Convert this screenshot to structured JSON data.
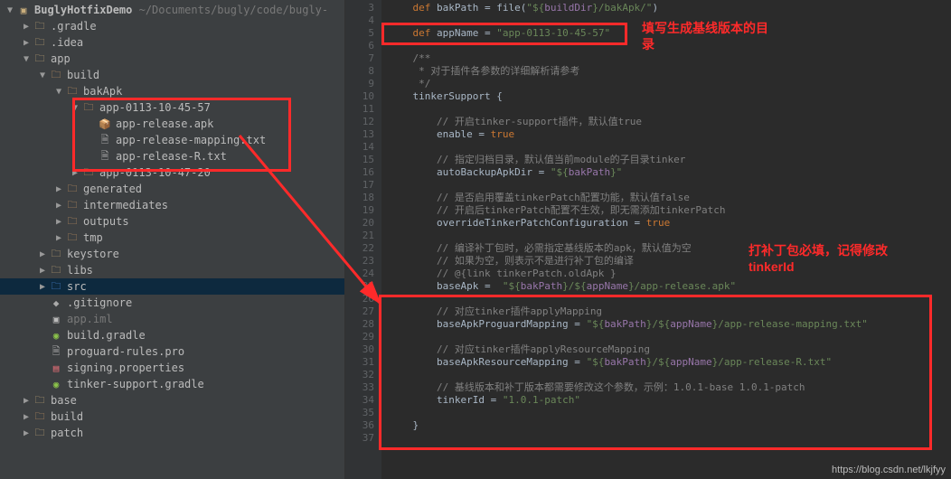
{
  "project": {
    "root_name": "BuglyHotfixDemo",
    "root_path": "~/Documents/bugly/code/bugly-",
    "tree": {
      "gradle": ".gradle",
      "idea": ".idea",
      "app": {
        "label": "app",
        "build": {
          "label": "build",
          "bakApk": {
            "label": "bakApk",
            "dir1": {
              "label": "app-0113-10-45-57",
              "f1": "app-release.apk",
              "f2": "app-release-mapping.txt",
              "f3": "app-release-R.txt"
            },
            "dir2": "app-0113-10-47-20"
          },
          "generated": "generated",
          "intermediates": "intermediates",
          "outputs": "outputs",
          "tmp": "tmp"
        },
        "keystore": "keystore",
        "libs": "libs",
        "src": "src",
        "gitignore": ".gitignore",
        "appiml": "app.iml",
        "buildgradle": "build.gradle",
        "proguard": "proguard-rules.pro",
        "signing": "signing.properties",
        "tinker": "tinker-support.gradle"
      },
      "base": "base",
      "build": "build",
      "patch": "patch"
    }
  },
  "annotations": {
    "top": "填写生成基线版本的目录",
    "bottom": "打补丁包必填，记得修改tinkerId"
  },
  "watermark": "https://blog.csdn.net/lkjfyy",
  "code": {
    "lines": [
      {
        "n": 3,
        "indent": 1,
        "segs": [
          {
            "t": "def ",
            "c": "kw"
          },
          {
            "t": "bakPath = file(",
            "c": ""
          },
          {
            "t": "\"${",
            "c": "str"
          },
          {
            "t": "buildDir",
            "c": "prop"
          },
          {
            "t": "}/bakApk/\"",
            "c": "str"
          },
          {
            "t": ")",
            "c": ""
          }
        ]
      },
      {
        "n": 4,
        "indent": 0,
        "segs": []
      },
      {
        "n": 5,
        "indent": 1,
        "segs": [
          {
            "t": "def ",
            "c": "kw"
          },
          {
            "t": "appName = ",
            "c": ""
          },
          {
            "t": "\"app-0113-10-45-57\"",
            "c": "str"
          }
        ]
      },
      {
        "n": 6,
        "indent": 0,
        "segs": []
      },
      {
        "n": 7,
        "indent": 1,
        "segs": [
          {
            "t": "/**",
            "c": "cmt"
          }
        ]
      },
      {
        "n": 8,
        "indent": 1,
        "segs": [
          {
            "t": " * 对于插件各参数的详细解析请参考",
            "c": "cmt"
          }
        ]
      },
      {
        "n": 9,
        "indent": 1,
        "segs": [
          {
            "t": " */",
            "c": "cmt"
          }
        ]
      },
      {
        "n": 10,
        "indent": 1,
        "segs": [
          {
            "t": "tinkerSupport {",
            "c": ""
          }
        ]
      },
      {
        "n": 11,
        "indent": 0,
        "segs": []
      },
      {
        "n": 12,
        "indent": 2,
        "segs": [
          {
            "t": "// 开启tinker-support插件，默认值true",
            "c": "cmt"
          }
        ]
      },
      {
        "n": 13,
        "indent": 2,
        "segs": [
          {
            "t": "enable = ",
            "c": ""
          },
          {
            "t": "true",
            "c": "lit"
          }
        ]
      },
      {
        "n": 14,
        "indent": 0,
        "segs": []
      },
      {
        "n": 15,
        "indent": 2,
        "segs": [
          {
            "t": "// 指定归档目录，默认值当前module的子目录tinker",
            "c": "cmt"
          }
        ]
      },
      {
        "n": 16,
        "indent": 2,
        "segs": [
          {
            "t": "autoBackupApkDir = ",
            "c": ""
          },
          {
            "t": "\"${",
            "c": "str"
          },
          {
            "t": "bakPath",
            "c": "prop"
          },
          {
            "t": "}\"",
            "c": "str"
          }
        ]
      },
      {
        "n": 17,
        "indent": 0,
        "segs": []
      },
      {
        "n": 18,
        "indent": 2,
        "segs": [
          {
            "t": "// 是否启用覆盖tinkerPatch配置功能，默认值false",
            "c": "cmt"
          }
        ]
      },
      {
        "n": 19,
        "indent": 2,
        "segs": [
          {
            "t": "// 开启后tinkerPatch配置不生效，即无需添加tinkerPatch",
            "c": "cmt"
          }
        ]
      },
      {
        "n": 20,
        "indent": 2,
        "segs": [
          {
            "t": "overrideTinkerPatchConfiguration = ",
            "c": ""
          },
          {
            "t": "true",
            "c": "lit"
          }
        ]
      },
      {
        "n": 21,
        "indent": 0,
        "segs": []
      },
      {
        "n": 22,
        "indent": 2,
        "segs": [
          {
            "t": "// 编译补丁包时，必需指定基线版本的apk，默认值为空",
            "c": "cmt"
          }
        ]
      },
      {
        "n": 23,
        "indent": 2,
        "segs": [
          {
            "t": "// 如果为空，则表示不是进行补丁包的编译",
            "c": "cmt"
          }
        ]
      },
      {
        "n": 24,
        "indent": 2,
        "segs": [
          {
            "t": "// @{link tinkerPatch.oldApk }",
            "c": "cmt"
          }
        ]
      },
      {
        "n": 25,
        "indent": 2,
        "segs": [
          {
            "t": "baseApk =  ",
            "c": ""
          },
          {
            "t": "\"${",
            "c": "str"
          },
          {
            "t": "bakPath",
            "c": "prop"
          },
          {
            "t": "}/${",
            "c": "str"
          },
          {
            "t": "appName",
            "c": "prop"
          },
          {
            "t": "}/app-release.apk\"",
            "c": "str"
          }
        ]
      },
      {
        "n": 26,
        "indent": 0,
        "segs": []
      },
      {
        "n": 27,
        "indent": 2,
        "segs": [
          {
            "t": "// 对应tinker插件applyMapping",
            "c": "cmt"
          }
        ]
      },
      {
        "n": 28,
        "indent": 2,
        "segs": [
          {
            "t": "baseApkProguardMapping = ",
            "c": ""
          },
          {
            "t": "\"${",
            "c": "str"
          },
          {
            "t": "bakPath",
            "c": "prop"
          },
          {
            "t": "}/${",
            "c": "str"
          },
          {
            "t": "appName",
            "c": "prop"
          },
          {
            "t": "}/app-release-mapping.txt\"",
            "c": "str"
          }
        ]
      },
      {
        "n": 29,
        "indent": 0,
        "segs": []
      },
      {
        "n": 30,
        "indent": 2,
        "segs": [
          {
            "t": "// 对应tinker插件applyResourceMapping",
            "c": "cmt"
          }
        ]
      },
      {
        "n": 31,
        "indent": 2,
        "segs": [
          {
            "t": "baseApkResourceMapping = ",
            "c": ""
          },
          {
            "t": "\"${",
            "c": "str"
          },
          {
            "t": "bakPath",
            "c": "prop"
          },
          {
            "t": "}/${",
            "c": "str"
          },
          {
            "t": "appName",
            "c": "prop"
          },
          {
            "t": "}/app-release-R.txt\"",
            "c": "str"
          }
        ]
      },
      {
        "n": 32,
        "indent": 0,
        "segs": []
      },
      {
        "n": 33,
        "indent": 2,
        "segs": [
          {
            "t": "// 基线版本和补丁版本都需要修改这个参数，示例：1.0.1-base 1.0.1-patch",
            "c": "cmt"
          }
        ]
      },
      {
        "n": 34,
        "indent": 2,
        "segs": [
          {
            "t": "tinkerId = ",
            "c": ""
          },
          {
            "t": "\"1.0.1-patch\"",
            "c": "str"
          }
        ]
      },
      {
        "n": 35,
        "indent": 0,
        "segs": []
      },
      {
        "n": 36,
        "indent": 1,
        "segs": [
          {
            "t": "}",
            "c": ""
          }
        ]
      },
      {
        "n": 37,
        "indent": 0,
        "segs": []
      }
    ]
  }
}
